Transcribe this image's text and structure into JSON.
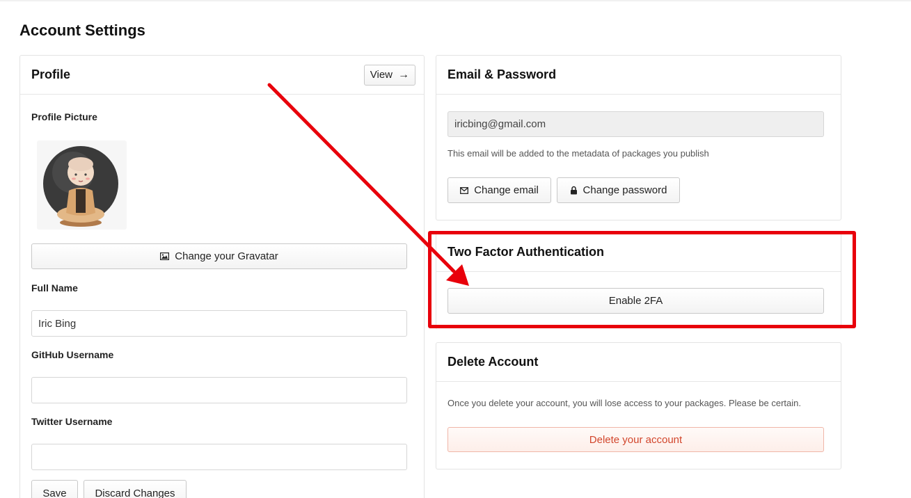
{
  "page": {
    "title": "Account Settings"
  },
  "profile": {
    "title": "Profile",
    "view_label": "View",
    "picture_label": "Profile Picture",
    "gravatar_label": "Change your Gravatar",
    "full_name_label": "Full Name",
    "full_name_value": "Iric Bing",
    "github_label": "GitHub Username",
    "github_value": "",
    "twitter_label": "Twitter Username",
    "twitter_value": "",
    "save_label": "Save",
    "discard_label": "Discard Changes"
  },
  "email_password": {
    "title": "Email & Password",
    "email_value": "iricbing@gmail.com",
    "helper": "This email will be added to the metadata of packages you publish",
    "change_email_label": "Change email",
    "change_password_label": "Change password"
  },
  "two_factor": {
    "title": "Two Factor Authentication",
    "enable_label": "Enable 2FA"
  },
  "delete_account": {
    "title": "Delete Account",
    "helper": "Once you delete your account, you will lose access to your packages. Please be certain.",
    "delete_label": "Delete your account"
  },
  "annotation": {
    "color": "#e8000b"
  }
}
